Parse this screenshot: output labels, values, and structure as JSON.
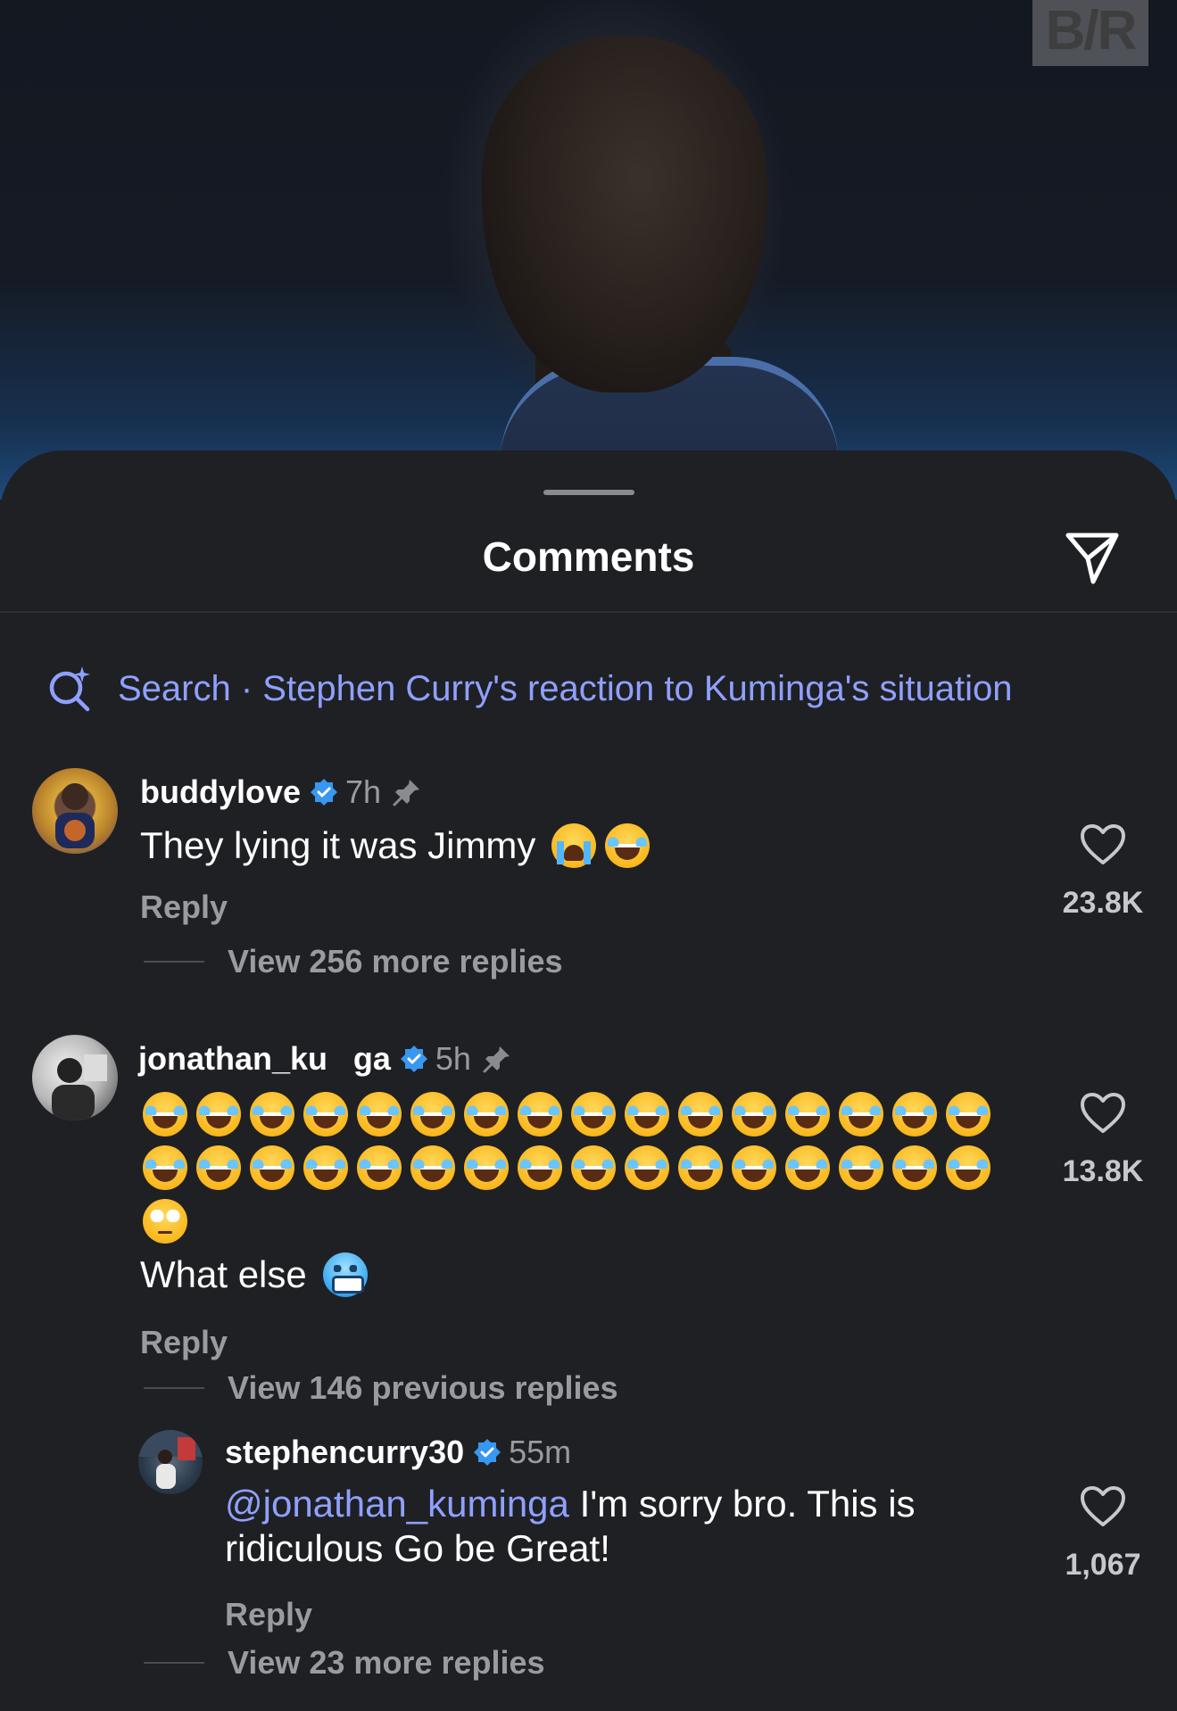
{
  "photo": {
    "watermark": "B/R"
  },
  "sheet": {
    "title": "Comments",
    "search_label": "Search · Stephen Curry's reaction to Kuminga's situation"
  },
  "comments": [
    {
      "username": "buddylove",
      "time": "7h",
      "text": "They lying it was Jimmy",
      "emojis": [
        "loudly-crying-face",
        "face-with-tears-of-joy"
      ],
      "reply_label": "Reply",
      "likes": "23.8K",
      "view_replies": "View 256 more replies"
    },
    {
      "username": "jonathan_ku    ga",
      "time": "5h",
      "emoji_lines": [
        "face-with-tears-of-joy x16",
        "face-with-tears-of-joy x16",
        "face-with-rolling-eyes"
      ],
      "text": "What else",
      "trailing_emoji": "cold-face",
      "reply_label": "Reply",
      "likes": "13.8K",
      "view_replies": "View 146 previous replies"
    },
    {
      "username": "stephencurry30",
      "time": "55m",
      "mention": "@jonathan_kuminga",
      "text_line1": " I'm sorry bro. This is",
      "text_line2": "ridiculous Go be Great!",
      "reply_label": "Reply",
      "likes": "1,067",
      "view_replies": "View 23 more replies"
    }
  ],
  "colors": {
    "background": "#1f2024",
    "link_blue": "#8fa0ff",
    "verified_blue": "#3897f0",
    "muted_text": "#9a9ba0"
  },
  "icons": [
    "send-icon",
    "search-sparkle-icon",
    "verified-badge-icon",
    "pin-icon",
    "heart-icon"
  ]
}
